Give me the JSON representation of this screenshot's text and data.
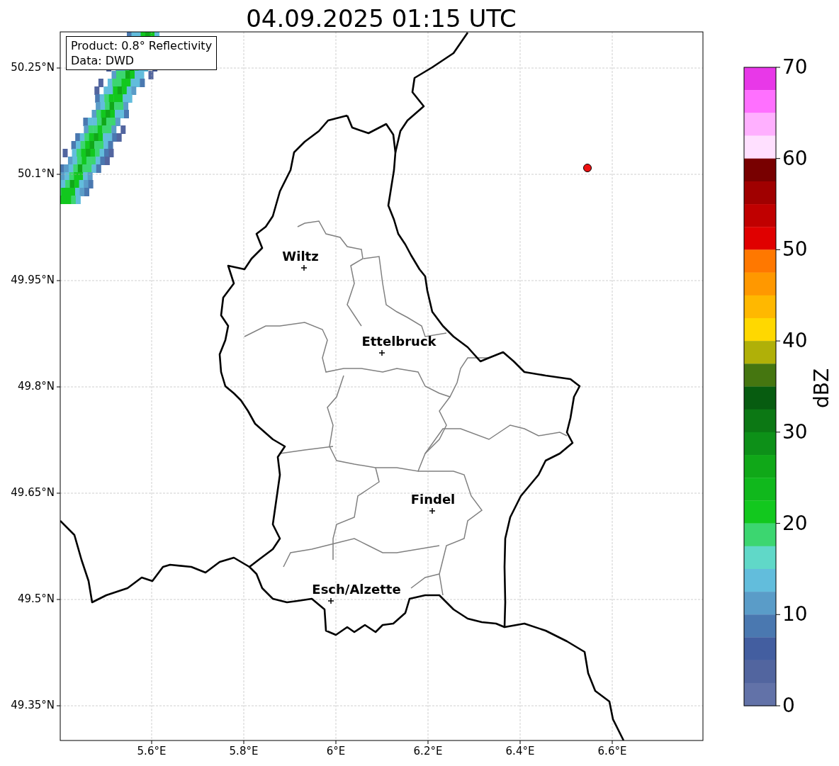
{
  "title": "04.09.2025 01:15 UTC",
  "info_box": [
    "Product: 0.8° Reflectivity",
    "Data: DWD"
  ],
  "map": {
    "y_ticks": [
      "50.25°N",
      "50.1°N",
      "49.95°N",
      "49.8°N",
      "49.65°N",
      "49.5°N",
      "49.35°N"
    ],
    "x_ticks": [
      "5.6°E",
      "5.8°E",
      "6°E",
      "6.2°E",
      "6.4°E",
      "6.6°E"
    ],
    "cities": [
      {
        "name": "Wiltz"
      },
      {
        "name": "Ettelbruck"
      },
      {
        "name": "Findel"
      },
      {
        "name": "Esch/Alzette"
      }
    ]
  },
  "colorbar": {
    "label": "dBZ",
    "ticks": [
      "70",
      "60",
      "50",
      "40",
      "30",
      "20",
      "10",
      "0"
    ],
    "bands": [
      {
        "color": "#e838e8"
      },
      {
        "color": "#ff70ff"
      },
      {
        "color": "#ffb0ff"
      },
      {
        "color": "#ffe0ff"
      },
      {
        "color": "#780000"
      },
      {
        "color": "#a00000"
      },
      {
        "color": "#c00000"
      },
      {
        "color": "#e00000"
      },
      {
        "color": "#ff7800"
      },
      {
        "color": "#ff9800"
      },
      {
        "color": "#ffb800"
      },
      {
        "color": "#ffd800"
      },
      {
        "color": "#b0b008"
      },
      {
        "color": "#457610"
      },
      {
        "color": "#075c10"
      },
      {
        "color": "#0c7814"
      },
      {
        "color": "#0d9018"
      },
      {
        "color": "#10a818"
      },
      {
        "color": "#10b81c"
      },
      {
        "color": "#12c81e"
      },
      {
        "color": "#3cd670"
      },
      {
        "color": "#60d8c8"
      },
      {
        "color": "#62bddc"
      },
      {
        "color": "#5a9cc8"
      },
      {
        "color": "#4a78b0"
      },
      {
        "color": "#435ea0"
      },
      {
        "color": "#52659f"
      },
      {
        "color": "#6272a8"
      }
    ]
  }
}
